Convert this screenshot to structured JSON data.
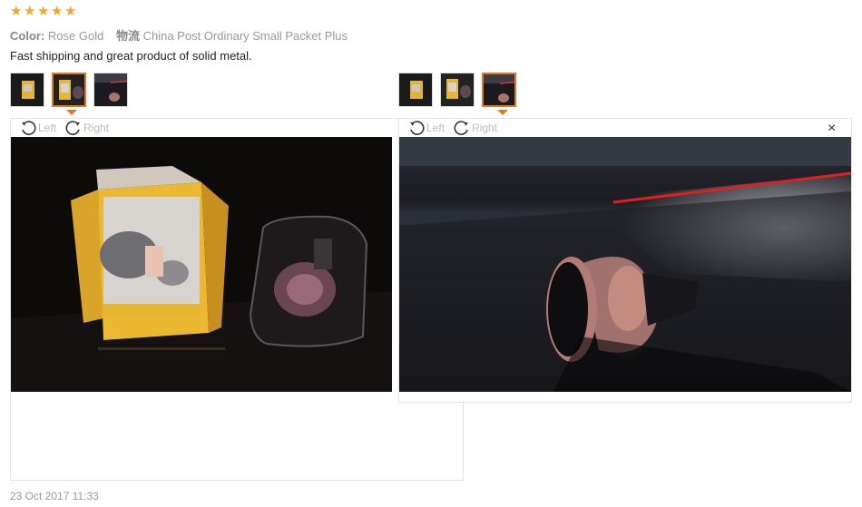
{
  "review": {
    "rating": 5,
    "color_label": "Color:",
    "color_value": "Rose Gold",
    "shipping_label": "物流",
    "shipping_value": "China Post Ordinary Small Packet Plus",
    "text": "Fast shipping and great product of solid metal.",
    "date": "23 Oct 2017 11:33"
  },
  "viewer_left": {
    "rotate_left": "Left",
    "rotate_right": "Right"
  },
  "viewer_right": {
    "rotate_left": "Left",
    "rotate_right": "Right",
    "close": "×"
  },
  "colors": {
    "star": "#f5a623",
    "active_border": "#e8761e"
  }
}
